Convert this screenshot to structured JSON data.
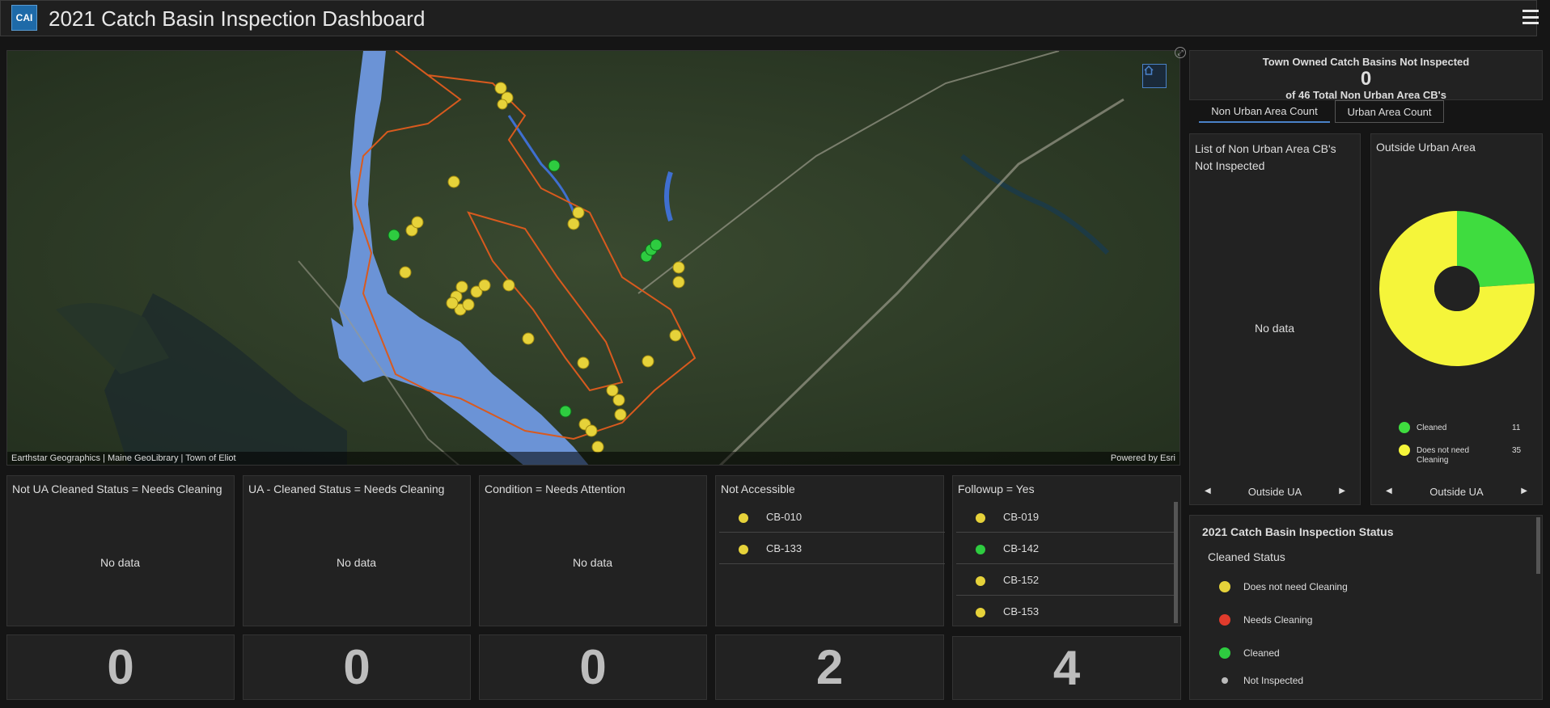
{
  "header": {
    "logo_text": "CAI",
    "title": "2021 Catch Basin Inspection Dashboard"
  },
  "map": {
    "attribution_left": "Earthstar Geographics | Maine GeoLibrary | Town of Eliot",
    "attribution_right": "Powered by Esri",
    "point_colors": {
      "yellow": "#e6d23a",
      "green": "#2ecc40"
    }
  },
  "top_indicator": {
    "title": "Town Owned Catch Basins Not Inspected",
    "value": "0",
    "bottom": "of 46 Total Non Urban Area CB's"
  },
  "tabs": [
    {
      "label": "Non Urban Area Count",
      "active": true
    },
    {
      "label": "Urban Area Count",
      "active": false
    }
  ],
  "list_nonurban": {
    "title": "List of Non Urban Area CB's Not Inspected",
    "nodata": "No data",
    "pager": "Outside UA"
  },
  "pie": {
    "title": "Outside Urban Area",
    "pager": "Outside UA",
    "legend": [
      {
        "label": "Cleaned",
        "count": "11",
        "color": "#3fdc3f"
      },
      {
        "label": "Does not need Cleaning",
        "count": "35",
        "color": "#f5f53a"
      }
    ]
  },
  "status": {
    "title": "2021 Catch Basin Inspection Status",
    "subtitle": "Cleaned Status",
    "items": [
      {
        "label": "Does not need Cleaning",
        "color": "#e6d23a"
      },
      {
        "label": "Needs Cleaning",
        "color": "#e03b2c"
      },
      {
        "label": "Cleaned",
        "color": "#2ecc40"
      },
      {
        "label": "Not Inspected",
        "color": "#bbbbbb"
      }
    ]
  },
  "lists": [
    {
      "title": "Not UA Cleaned Status = Needs Cleaning",
      "nodata": "No data",
      "count": "0"
    },
    {
      "title": "UA - Cleaned Status = Needs Cleaning",
      "nodata": "No data",
      "count": "0"
    },
    {
      "title": "Condition = Needs Attention",
      "nodata": "No data",
      "count": "0"
    },
    {
      "title": "Not Accessible",
      "count": "2",
      "items": [
        {
          "label": "CB-010",
          "color": "#e6d23a"
        },
        {
          "label": "CB-133",
          "color": "#e6d23a"
        }
      ]
    },
    {
      "title": "Followup = Yes",
      "count": "4",
      "items": [
        {
          "label": "CB-019",
          "color": "#e6d23a"
        },
        {
          "label": "CB-142",
          "color": "#2ecc40"
        },
        {
          "label": "CB-152",
          "color": "#e6d23a"
        },
        {
          "label": "CB-153",
          "color": "#e6d23a"
        }
      ]
    }
  ]
}
